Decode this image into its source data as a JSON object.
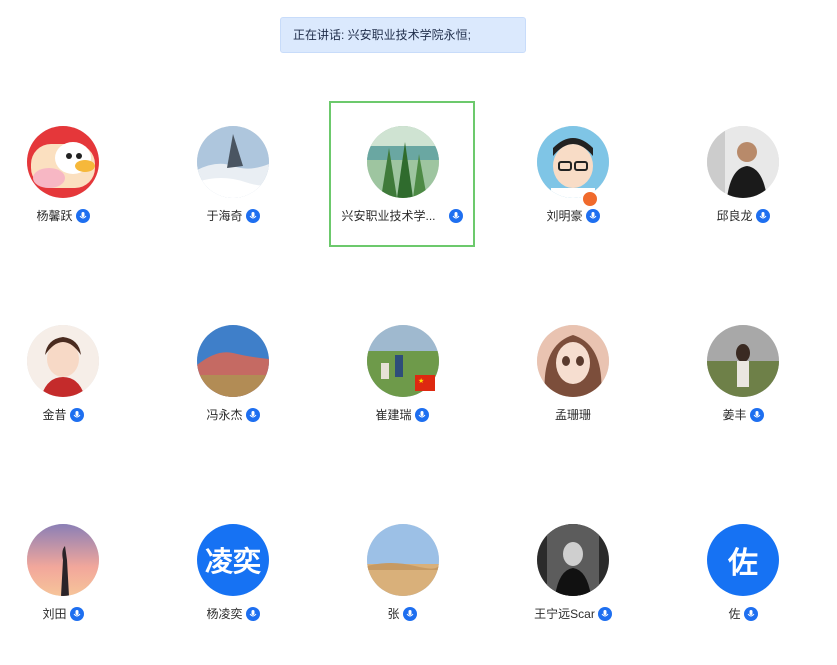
{
  "speaking": {
    "text": "正在讲话: 兴安职业技术学院永恒;"
  },
  "participants": [
    {
      "name": "杨馨跃",
      "avatar": "cartoon-duck",
      "mic": "mic-icon"
    },
    {
      "name": "于海奇",
      "avatar": "mountain-clouds",
      "mic": "mic-icon"
    },
    {
      "name": "兴安职业技术学...",
      "avatar": "lake-trees",
      "mic": "mic-icon",
      "active": true
    },
    {
      "name": "刘明豪",
      "avatar": "cartoon-man-glasses",
      "mic": "mic-icon",
      "host": true
    },
    {
      "name": "邱良龙",
      "avatar": "speaker-photo",
      "mic": "mic-icon"
    },
    {
      "name": "金昔",
      "avatar": "cartoon-woman",
      "mic": "mic-icon"
    },
    {
      "name": "冯永杰",
      "avatar": "red-mountain",
      "mic": "mic-icon"
    },
    {
      "name": "崔建瑞",
      "avatar": "grass-field-people",
      "mic": "mic-icon",
      "flag": true
    },
    {
      "name": "孟珊珊",
      "avatar": "cartoon-girl",
      "mic": null
    },
    {
      "name": "姜丰",
      "avatar": "woman-grass",
      "mic": "mic-icon"
    },
    {
      "name": "刘田",
      "avatar": "sunset-silhouette",
      "mic": "mic-icon"
    },
    {
      "name": "杨凌奕",
      "avatar_text": "凌奕",
      "mic": "mic-icon"
    },
    {
      "name": "张",
      "avatar": "desert",
      "mic": "mic-icon"
    },
    {
      "name": "王宁远Scar",
      "avatar": "mirror-selfie",
      "mic": "mic-icon"
    },
    {
      "name": "佐",
      "avatar_text": "佐",
      "mic": "mic-icon"
    }
  ]
}
